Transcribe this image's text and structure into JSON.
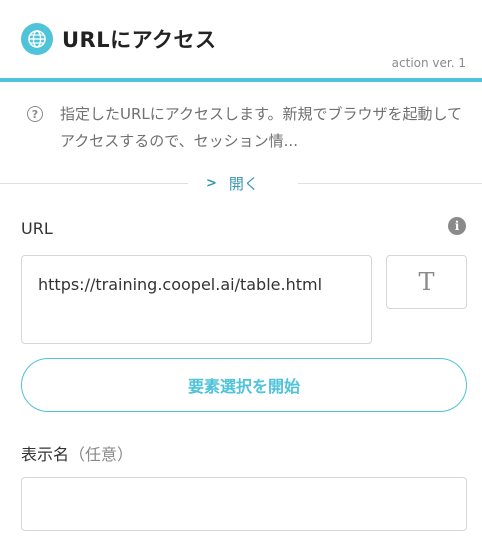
{
  "header": {
    "title": "URLにアクセス",
    "version": "action ver. 1",
    "icon": "globe-icon",
    "accent_color": "#4ec3d9"
  },
  "description": {
    "icon": "help-icon",
    "text": "指定したURLにアクセスします。新規でブラウザを起動してアクセスするので、セッション情..."
  },
  "toggle": {
    "icon": "chevron-right-icon",
    "label": "開く"
  },
  "url_field": {
    "label": "URL",
    "info_icon": "info-icon",
    "value": "https://training.coopel.ai/table.html",
    "text_mode_glyph": "T"
  },
  "select_button": {
    "label": "要素選択を開始"
  },
  "display_name": {
    "label": "表示名",
    "optional": "（任意）",
    "value": ""
  }
}
